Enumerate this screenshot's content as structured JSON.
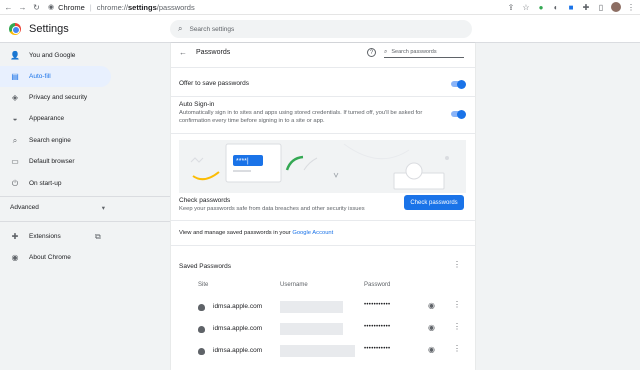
{
  "browser": {
    "tab_label": "Chrome",
    "url_host": "chrome://",
    "url_path_bold": "settings",
    "url_path": "/passwords",
    "nav_back_icon": "back-icon",
    "nav_forward_icon": "forward-icon",
    "nav_reload_icon": "reload-icon"
  },
  "header": {
    "title": "Settings",
    "search_placeholder": "Search settings"
  },
  "sidebar": {
    "items": [
      {
        "label": "You and Google",
        "icon": "person-icon"
      },
      {
        "label": "Auto-fill",
        "icon": "autofill-icon",
        "active": true
      },
      {
        "label": "Privacy and security",
        "icon": "shield-icon"
      },
      {
        "label": "Appearance",
        "icon": "palette-icon"
      },
      {
        "label": "Search engine",
        "icon": "search-icon"
      },
      {
        "label": "Default browser",
        "icon": "browser-icon"
      },
      {
        "label": "On start-up",
        "icon": "power-icon"
      }
    ],
    "advanced": "Advanced",
    "extensions": "Extensions",
    "about": "About Chrome"
  },
  "passwords": {
    "title": "Passwords",
    "search_placeholder": "Search passwords",
    "offer_label": "Offer to save passwords",
    "auto_signin_label": "Auto Sign-in",
    "auto_signin_desc_1": "Automatically sign in to sites and apps using stored credentials. If turned off, you'll be asked for",
    "auto_signin_desc_2": "confirmation every time before signing in to a site or app.",
    "check_title": "Check passwords",
    "check_desc": "Keep your passwords safe from data breaches and other security issues",
    "check_button": "Check passwords",
    "manage_text": "View and manage saved passwords in your ",
    "manage_link": "Google Account",
    "saved_title": "Saved Passwords",
    "col_site": "Site",
    "col_username": "Username",
    "col_password": "Password",
    "rows": [
      {
        "site": "idmsa.apple.com",
        "password": "•••••••••••"
      },
      {
        "site": "idmsa.apple.com",
        "password": "•••••••••••"
      },
      {
        "site": "idmsa.apple.com",
        "password": "•••••••••••"
      }
    ]
  },
  "colors": {
    "accent": "#1a73e8",
    "active_bg": "#e8f0fe"
  }
}
